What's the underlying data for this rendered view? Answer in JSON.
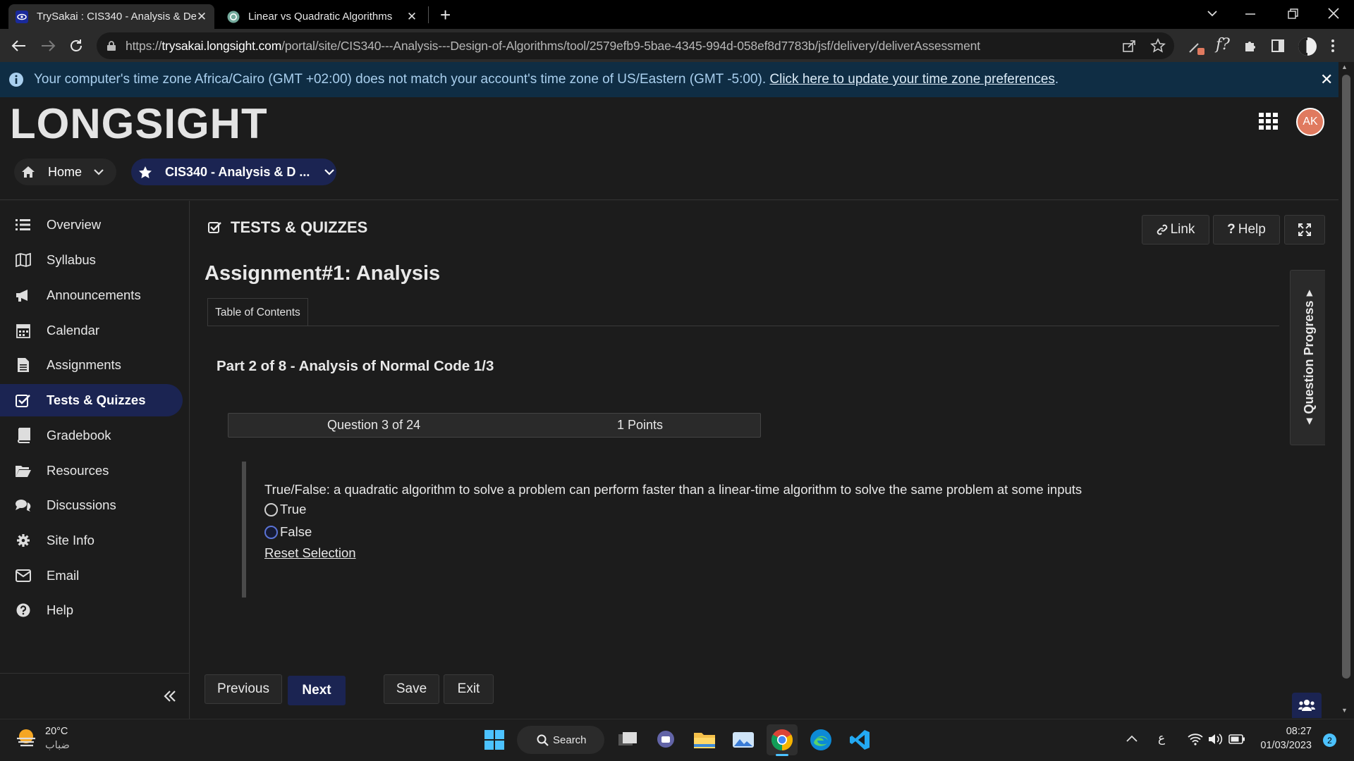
{
  "browser": {
    "tabs": [
      {
        "title": "TrySakai : CIS340 - Analysis & De",
        "active": true
      },
      {
        "title": "Linear vs Quadratic Algorithms",
        "active": false
      }
    ],
    "url_prefix": "https://",
    "url_host": "trysakai.longsight.com",
    "url_path": "/portal/site/CIS340---Analysis---Design-of-Algorithms/tool/2579efb9-5bae-4345-994d-058ef8d7783b/jsf/delivery/deliverAssessment"
  },
  "banner": {
    "message": "Your computer's time zone Africa/Cairo (GMT +02:00) does not match your account's time zone of US/Eastern (GMT -5:00).",
    "link": "Click here to update your time zone preferences",
    "link_suffix": "."
  },
  "header": {
    "logo": "LONGSIGHT",
    "avatar_initials": "AK",
    "home_label": "Home",
    "site_label": "CIS340 - Analysis & D ..."
  },
  "sidebar": {
    "items": [
      {
        "label": "Overview",
        "icon": "list-icon"
      },
      {
        "label": "Syllabus",
        "icon": "book-icon"
      },
      {
        "label": "Announcements",
        "icon": "bullhorn-icon"
      },
      {
        "label": "Calendar",
        "icon": "calendar-icon"
      },
      {
        "label": "Assignments",
        "icon": "file-icon"
      },
      {
        "label": "Tests & Quizzes",
        "icon": "check-square-icon",
        "selected": true
      },
      {
        "label": "Gradebook",
        "icon": "gradebook-icon"
      },
      {
        "label": "Resources",
        "icon": "folder-icon"
      },
      {
        "label": "Discussions",
        "icon": "comments-icon"
      },
      {
        "label": "Site Info",
        "icon": "gear-icon"
      },
      {
        "label": "Email",
        "icon": "envelope-icon"
      },
      {
        "label": "Help",
        "icon": "question-icon"
      }
    ]
  },
  "tool": {
    "title": "TESTS & QUIZZES",
    "link_label": "Link",
    "help_label": "Help"
  },
  "assessment": {
    "title": "Assignment#1: Analysis",
    "toc_label": "Table of Contents",
    "part_title": "Part 2 of 8 - Analysis of Normal Code 1/3",
    "question_counter": "Question 3 of 24",
    "points": "1 Points",
    "question_text": "True/False: a quadratic algorithm to solve a problem can perform faster than a linear-time algorithm to solve the same problem at some inputs",
    "options": [
      "True",
      "False"
    ],
    "reset_label": "Reset Selection",
    "progress_label": "Question Progress"
  },
  "footer_buttons": {
    "previous": "Previous",
    "next": "Next",
    "save": "Save",
    "exit": "Exit"
  },
  "taskbar": {
    "weather_temp": "20°C",
    "weather_desc": "ضباب",
    "search_label": "Search",
    "lang": "ع",
    "time": "08:27",
    "date": "01/03/2023",
    "notifications": "2"
  },
  "colors": {
    "accent_nav": "#1b2452",
    "banner_bg": "#0f2d44",
    "avatar": "#e07a5f"
  }
}
